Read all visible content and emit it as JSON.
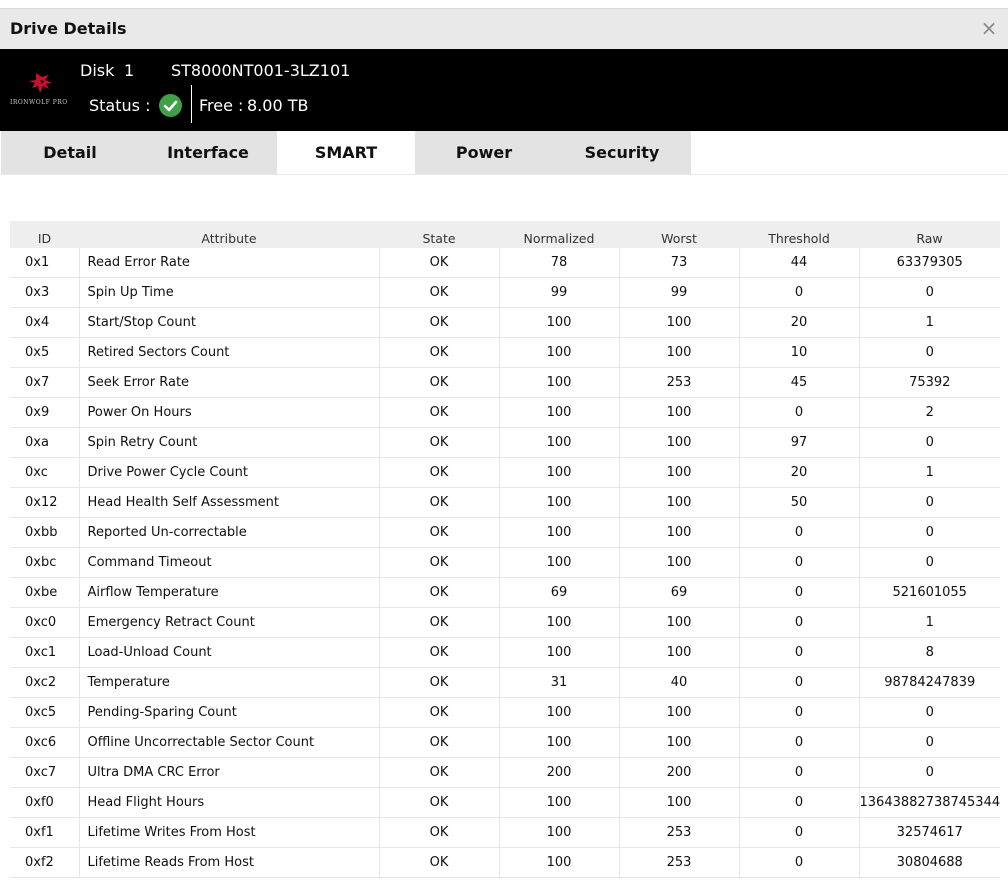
{
  "window": {
    "title": "Drive Details",
    "close_glyph": "×"
  },
  "drive": {
    "logo_text": "IRONWOLF PRO",
    "logo_icon": "seagate-wolf-logo-icon",
    "disk_label": "Disk",
    "disk_number": "1",
    "model": "ST8000NT001-3LZ101",
    "status_label": "Status :",
    "status_icon": "check-circle-icon",
    "status_color": "#3fa045",
    "free_label": "Free :",
    "free_value": "8.00 TB"
  },
  "tabs": [
    {
      "label": "Detail",
      "active": false
    },
    {
      "label": "Interface",
      "active": false
    },
    {
      "label": "SMART",
      "active": true
    },
    {
      "label": "Power",
      "active": false
    },
    {
      "label": "Security",
      "active": false
    }
  ],
  "smart_table": {
    "columns": [
      "ID",
      "Attribute",
      "State",
      "Normalized",
      "Worst",
      "Threshold",
      "Raw"
    ],
    "rows": [
      [
        "0x1",
        "Read Error Rate",
        "OK",
        "78",
        "73",
        "44",
        "63379305"
      ],
      [
        "0x3",
        "Spin Up Time",
        "OK",
        "99",
        "99",
        "0",
        "0"
      ],
      [
        "0x4",
        "Start/Stop Count",
        "OK",
        "100",
        "100",
        "20",
        "1"
      ],
      [
        "0x5",
        "Retired Sectors Count",
        "OK",
        "100",
        "100",
        "10",
        "0"
      ],
      [
        "0x7",
        "Seek Error Rate",
        "OK",
        "100",
        "253",
        "45",
        "75392"
      ],
      [
        "0x9",
        "Power On Hours",
        "OK",
        "100",
        "100",
        "0",
        "2"
      ],
      [
        "0xa",
        "Spin Retry Count",
        "OK",
        "100",
        "100",
        "97",
        "0"
      ],
      [
        "0xc",
        "Drive Power Cycle Count",
        "OK",
        "100",
        "100",
        "20",
        "1"
      ],
      [
        "0x12",
        "Head Health Self Assessment",
        "OK",
        "100",
        "100",
        "50",
        "0"
      ],
      [
        "0xbb",
        "Reported Un-correctable",
        "OK",
        "100",
        "100",
        "0",
        "0"
      ],
      [
        "0xbc",
        "Command Timeout",
        "OK",
        "100",
        "100",
        "0",
        "0"
      ],
      [
        "0xbe",
        "Airflow Temperature",
        "OK",
        "69",
        "69",
        "0",
        "521601055"
      ],
      [
        "0xc0",
        "Emergency Retract Count",
        "OK",
        "100",
        "100",
        "0",
        "1"
      ],
      [
        "0xc1",
        "Load-Unload Count",
        "OK",
        "100",
        "100",
        "0",
        "8"
      ],
      [
        "0xc2",
        "Temperature",
        "OK",
        "31",
        "40",
        "0",
        "98784247839"
      ],
      [
        "0xc5",
        "Pending-Sparing Count",
        "OK",
        "100",
        "100",
        "0",
        "0"
      ],
      [
        "0xc6",
        "Offline Uncorrectable Sector Count",
        "OK",
        "100",
        "100",
        "0",
        "0"
      ],
      [
        "0xc7",
        "Ultra DMA CRC Error",
        "OK",
        "200",
        "200",
        "0",
        "0"
      ],
      [
        "0xf0",
        "Head Flight Hours",
        "OK",
        "100",
        "100",
        "0",
        "13643882738745344"
      ],
      [
        "0xf1",
        "Lifetime Writes From Host",
        "OK",
        "100",
        "253",
        "0",
        "32574617"
      ],
      [
        "0xf2",
        "Lifetime Reads From Host",
        "OK",
        "100",
        "253",
        "0",
        "30804688"
      ]
    ]
  }
}
